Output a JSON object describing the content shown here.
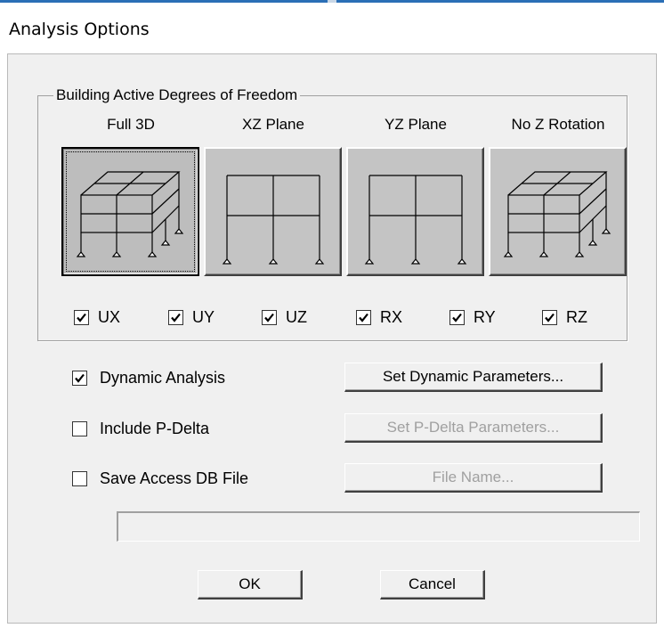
{
  "dialog": {
    "title": "Analysis Options"
  },
  "dof_group": {
    "legend": "Building Active Degrees of Freedom",
    "presets": [
      {
        "label": "Full 3D",
        "icon": "3d-building-frame-icon",
        "selected": true
      },
      {
        "label": "XZ Plane",
        "icon": "2d-plane-frame-icon",
        "selected": false
      },
      {
        "label": "YZ Plane",
        "icon": "2d-plane-frame-icon",
        "selected": false
      },
      {
        "label": "No Z Rotation",
        "icon": "3d-building-frame-icon",
        "selected": false
      }
    ],
    "dofs": [
      {
        "label": "UX",
        "checked": true
      },
      {
        "label": "UY",
        "checked": true
      },
      {
        "label": "UZ",
        "checked": true
      },
      {
        "label": "RX",
        "checked": true
      },
      {
        "label": "RY",
        "checked": true
      },
      {
        "label": "RZ",
        "checked": true
      }
    ]
  },
  "options": {
    "dynamic": {
      "label": "Dynamic Analysis",
      "checked": true,
      "button": "Set Dynamic Parameters...",
      "button_enabled": true
    },
    "pdelta": {
      "label": "Include P-Delta",
      "checked": false,
      "button": "Set P-Delta Parameters...",
      "button_enabled": false
    },
    "access_db": {
      "label": "Save Access DB File",
      "checked": false,
      "button": "File Name...",
      "button_enabled": false
    }
  },
  "file_path": {
    "value": ""
  },
  "footer": {
    "ok_label": "OK",
    "cancel_label": "Cancel"
  }
}
